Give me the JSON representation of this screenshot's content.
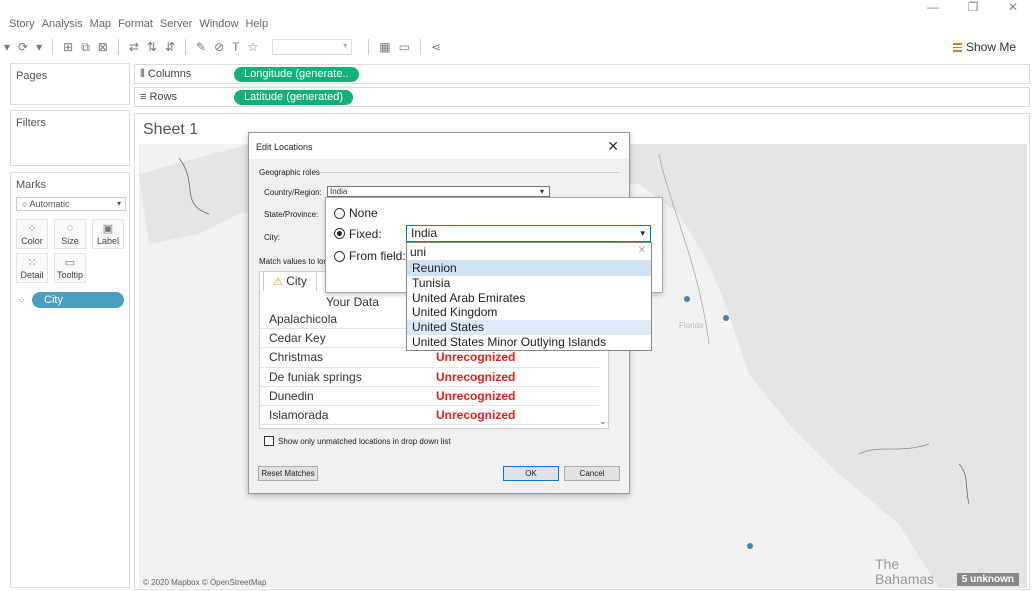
{
  "menu": [
    "Story",
    "Analysis",
    "Map",
    "Format",
    "Server",
    "Window",
    "Help"
  ],
  "window_controls": {
    "minimize": "—",
    "restore": "❐",
    "close": "✕"
  },
  "toolbar": {
    "show_me": "Show Me"
  },
  "panes": {
    "pages": "Pages",
    "filters": "Filters",
    "marks": "Marks"
  },
  "marks": {
    "type": "Automatic",
    "buttons": [
      "Color",
      "Size",
      "Label",
      "Detail",
      "Tooltip"
    ],
    "city_pill": "City"
  },
  "shelves": {
    "columns_label": "Columns",
    "columns_pill": "Longitude (generate..",
    "rows_label": "Rows",
    "rows_pill": "Latitude (generated)"
  },
  "sheet": {
    "title": "Sheet 1",
    "copyright": "© 2020 Mapbox © OpenStreetMap",
    "unknown_badge": "5 unknown",
    "map_label_florida": "Florida",
    "map_label_bahamas_1": "The",
    "map_label_bahamas_2": "Bahamas"
  },
  "dialog": {
    "title": "Edit Locations",
    "close": "✕",
    "group": "Geographic roles",
    "country_label": "Country/Region:",
    "country_value": "India",
    "state_label": "State/Province:",
    "city_label": "City:",
    "match_label": "Match values to loc",
    "tab": "City",
    "col_your_data": "Your Data",
    "rows": [
      {
        "name": "Apalachicola",
        "status": ""
      },
      {
        "name": "Cedar Key",
        "status": ""
      },
      {
        "name": "Christmas",
        "status": "Unrecognized"
      },
      {
        "name": "De funiak springs",
        "status": "Unrecognized"
      },
      {
        "name": "Dunedin",
        "status": "Unrecognized"
      },
      {
        "name": "Islamorada",
        "status": "Unrecognized"
      }
    ],
    "show_unmatched": "Show only unmatched locations in drop down list",
    "reset": "Reset Matches",
    "ok": "OK",
    "cancel": "Cancel"
  },
  "popup": {
    "none": "None",
    "fixed": "Fixed:",
    "from_field": "From field:",
    "fixed_value": "India",
    "search_value": "uni",
    "options": [
      "Reunion",
      "Tunisia",
      "United Arab Emirates",
      "United Kingdom",
      "United States",
      "United States Minor Outlying Islands"
    ]
  }
}
